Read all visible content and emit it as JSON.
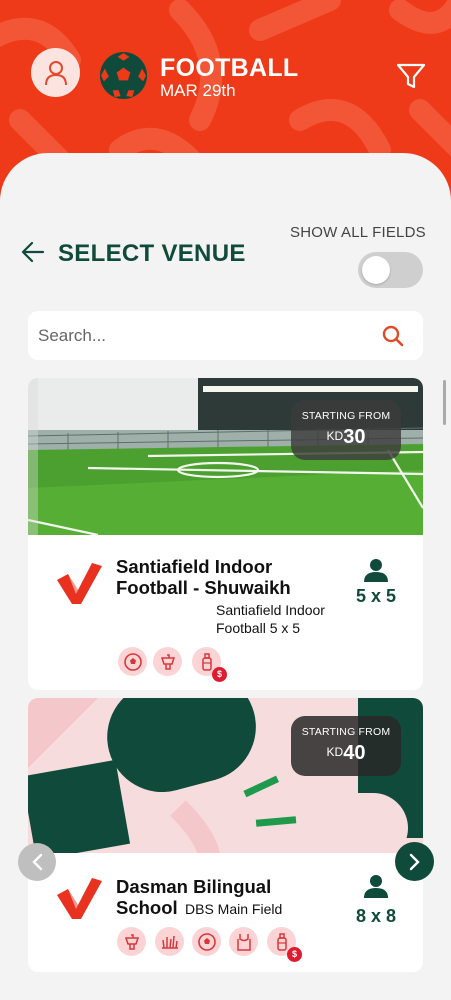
{
  "header": {
    "sport_title": "FOOTBALL",
    "date": "MAR 29th",
    "icons": {
      "profile": "user-icon",
      "sport": "football-icon",
      "filter": "filter-icon"
    },
    "colors": {
      "primary": "#ee3a18",
      "accent": "#0f4a3b"
    }
  },
  "venue_select": {
    "title": "SELECT VENUE",
    "show_all_label": "SHOW ALL FIELDS",
    "show_all_enabled": false
  },
  "search": {
    "placeholder": "Search..."
  },
  "venues": [
    {
      "name": "Santiafield Indoor Football - Shuwaikh",
      "field": "Santiafield Indoor Football 5 x 5",
      "price_label": "STARTING FROM",
      "currency": "KD",
      "price": "30",
      "players": "5 x 5",
      "amenities": [
        "football-icon",
        "drink-icon",
        "bottle-paid-icon"
      ]
    },
    {
      "name": "Dasman Bilingual School",
      "field": "DBS Main Field",
      "price_label": "STARTING FROM",
      "currency": "KD",
      "price": "40",
      "players": "8 x 8",
      "amenities": [
        "drink-icon",
        "grass-icon",
        "football-icon",
        "bib-icon",
        "bottle-paid-icon"
      ]
    }
  ],
  "paid_badge": "$"
}
